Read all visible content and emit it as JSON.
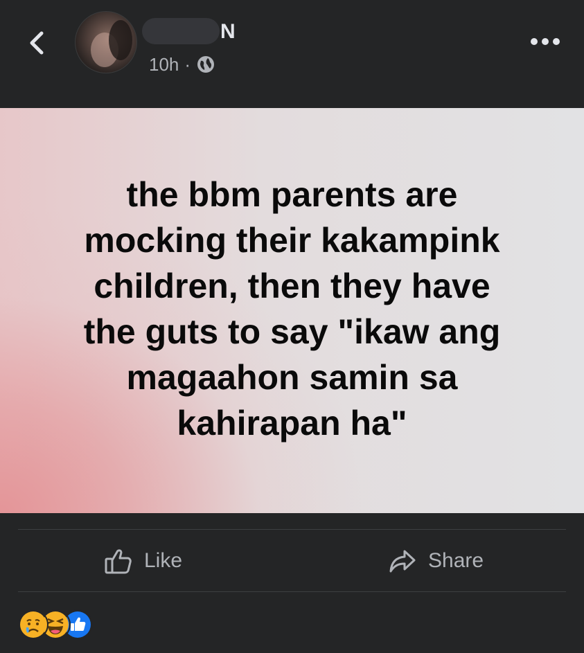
{
  "header": {
    "name_visible_suffix": "N",
    "time": "10h",
    "separator": "·",
    "privacy_icon": "globe-icon",
    "back_icon": "chevron-left-icon",
    "more_icon": "more-horizontal-icon"
  },
  "post": {
    "text": "the bbm parents are\nmocking their kakampink\nchildren, then they have\nthe guts to say \"ikaw ang\nmagaahon samin sa\nkahirapan ha\"",
    "text_color": "#0a0a0a",
    "background_colors": [
      "#e49598",
      "#e2e2e4"
    ]
  },
  "actions": {
    "like_label": "Like",
    "share_label": "Share",
    "like_icon": "thumbs-up-outline-icon",
    "share_icon": "share-arrow-icon"
  },
  "reactions": {
    "icons": [
      "sad-emoji-icon",
      "laugh-emoji-icon",
      "like-reaction-icon"
    ]
  },
  "colors": {
    "background": "#242526",
    "secondary_text": "#b0b3b8",
    "primary_text": "#e4e6eb",
    "like_blue": "#1877f2"
  }
}
